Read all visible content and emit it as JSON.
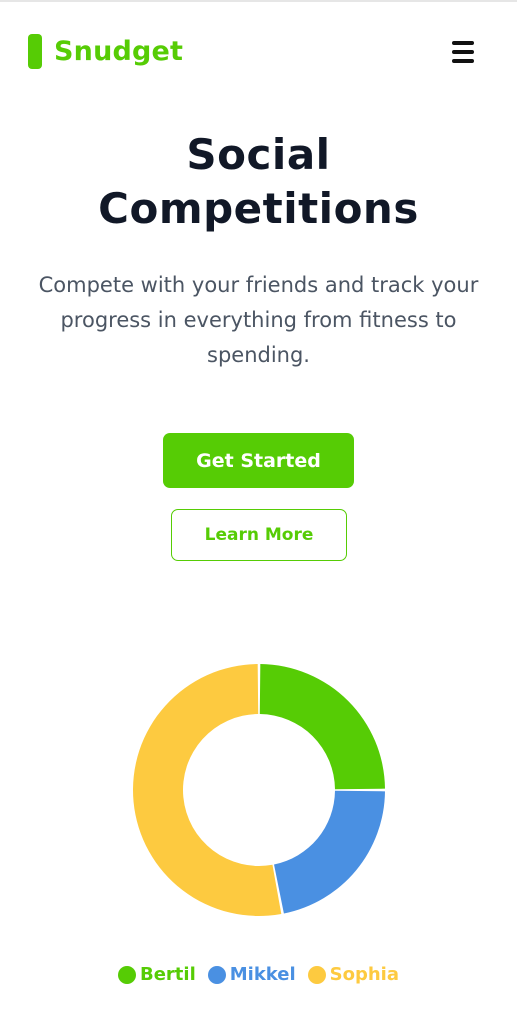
{
  "header": {
    "brand": "Snudget",
    "menu_icon": "hamburger-menu-icon"
  },
  "hero": {
    "title_line1": "Social",
    "title_line2": "Competitions",
    "subtitle": "Compete with your friends and track your progress in everything from fitness to spending."
  },
  "actions": {
    "primary_label": "Get Started",
    "secondary_label": "Learn More"
  },
  "colors": {
    "brand": "#56cc05",
    "title": "#111827",
    "body_text": "#4b5563"
  },
  "chart_data": {
    "type": "pie",
    "variant": "doughnut",
    "categories": [
      "Bertil",
      "Mikkel",
      "Sophia"
    ],
    "values": [
      25,
      22,
      53
    ],
    "colors": [
      "#56cc05",
      "#4a90e2",
      "#fdca40"
    ],
    "title": "",
    "legend_position": "bottom"
  }
}
